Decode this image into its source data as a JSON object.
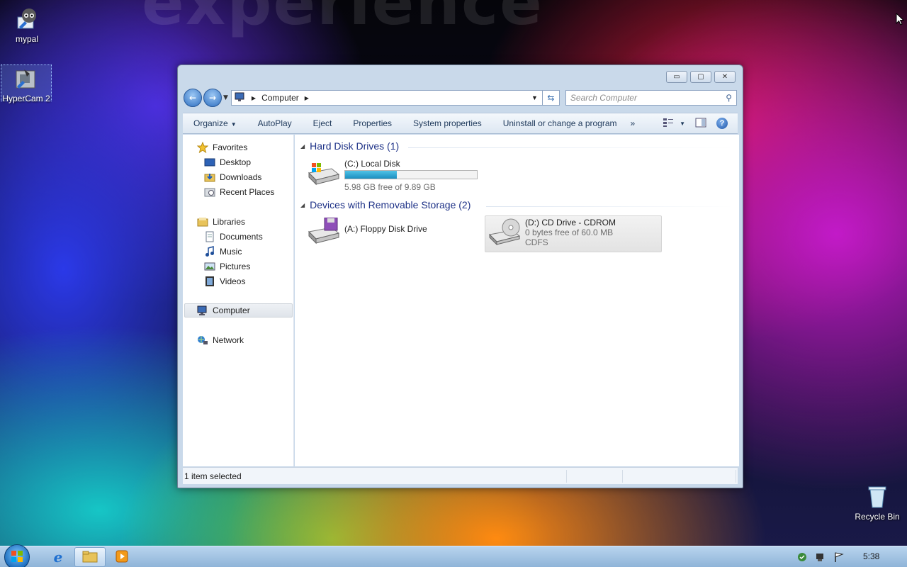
{
  "desktop": {
    "watermark": "experience",
    "icons": [
      {
        "label": "mypal"
      },
      {
        "label": "HyperCam 2"
      }
    ],
    "recycle_bin": "Recycle Bin"
  },
  "window": {
    "controls": {
      "minimize": "▭",
      "maximize": "▢",
      "close": "✕"
    },
    "address": {
      "location": "Computer"
    },
    "search": {
      "placeholder": "Search Computer"
    },
    "toolbar": {
      "organize": "Organize",
      "autoplay": "AutoPlay",
      "eject": "Eject",
      "properties": "Properties",
      "system_properties": "System properties",
      "uninstall": "Uninstall or change a program",
      "more": "»"
    },
    "nav_pane": {
      "favorites": "Favorites",
      "desktop": "Desktop",
      "downloads": "Downloads",
      "recent_places": "Recent Places",
      "libraries": "Libraries",
      "documents": "Documents",
      "music": "Music",
      "pictures": "Pictures",
      "videos": "Videos",
      "computer": "Computer",
      "network": "Network"
    },
    "groups": {
      "hard_disks": "Hard Disk Drives (1)",
      "removable": "Devices with Removable Storage (2)"
    },
    "drives": {
      "c": {
        "name": "(C:) Local Disk",
        "free": "5.98 GB free of 9.89 GB",
        "used_fraction": 0.395
      },
      "a": {
        "name": "(A:) Floppy Disk Drive"
      },
      "d": {
        "name": "(D:) CD Drive - CDROM",
        "free": "0 bytes free of 60.0 MB",
        "fs": "CDFS"
      }
    },
    "status": "1 item selected"
  },
  "taskbar": {
    "clock": "5:38"
  },
  "colors": {
    "accent": "#1b8fc0",
    "group_header": "#1e3287"
  }
}
